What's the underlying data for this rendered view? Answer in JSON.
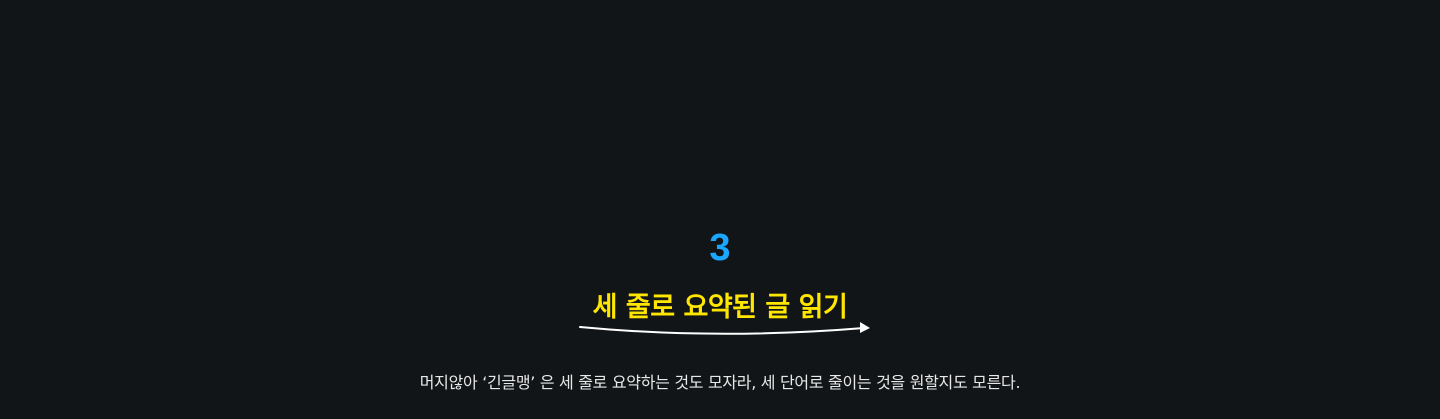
{
  "section": {
    "step_number": "3",
    "headline": "세 줄로 요약된 글 읽기",
    "description": "머지않아 ‘긴글맹’ 은 세 줄로 요약하는 것도 모자라, 세 단어로 줄이는 것을 원할지도 모른다."
  },
  "colors": {
    "background": "#121517",
    "step_number": "#1aa7ff",
    "headline": "#ffe600",
    "arrow": "#ffffff",
    "description": "#e8e8e8"
  },
  "icons": {
    "underline_arrow": "curved-arrow-right"
  }
}
